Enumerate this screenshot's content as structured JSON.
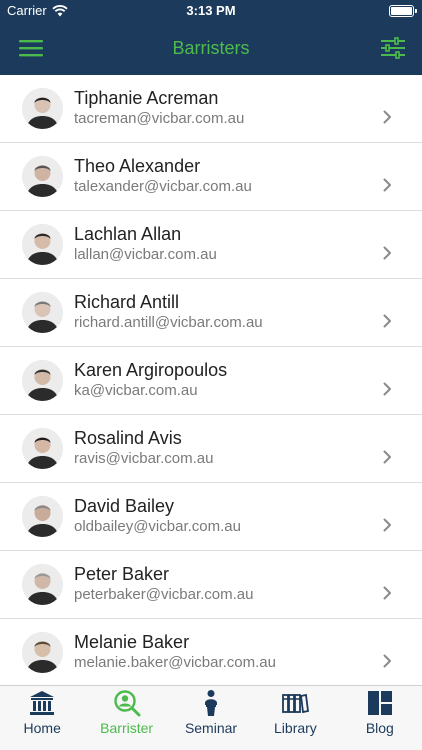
{
  "status_bar": {
    "carrier": "Carrier",
    "time": "3:13 PM"
  },
  "header": {
    "title": "Barristers",
    "menu_icon": "hamburger-icon",
    "filter_icon": "sliders-icon"
  },
  "colors": {
    "navy": "#1c3a5b",
    "accent_green": "#4cbb4c",
    "divider": "#dedede"
  },
  "barristers": [
    {
      "name": "Tiphanie Acreman",
      "email": "tacreman@vicbar.com.au"
    },
    {
      "name": "Theo Alexander",
      "email": "talexander@vicbar.com.au"
    },
    {
      "name": "Lachlan Allan",
      "email": "lallan@vicbar.com.au"
    },
    {
      "name": "Richard Antill",
      "email": "richard.antill@vicbar.com.au"
    },
    {
      "name": "Karen Argiropoulos",
      "email": "ka@vicbar.com.au"
    },
    {
      "name": "Rosalind Avis",
      "email": "ravis@vicbar.com.au"
    },
    {
      "name": "David Bailey",
      "email": "oldbailey@vicbar.com.au"
    },
    {
      "name": "Peter Baker",
      "email": "peterbaker@vicbar.com.au"
    },
    {
      "name": "Melanie Baker",
      "email": "melanie.baker@vicbar.com.au"
    }
  ],
  "tabs": [
    {
      "label": "Home",
      "icon": "bank-icon",
      "active": false
    },
    {
      "label": "Barrister",
      "icon": "person-search-icon",
      "active": true
    },
    {
      "label": "Seminar",
      "icon": "speaker-podium-icon",
      "active": false
    },
    {
      "label": "Library",
      "icon": "books-icon",
      "active": false
    },
    {
      "label": "Blog",
      "icon": "layout-icon",
      "active": false
    }
  ]
}
